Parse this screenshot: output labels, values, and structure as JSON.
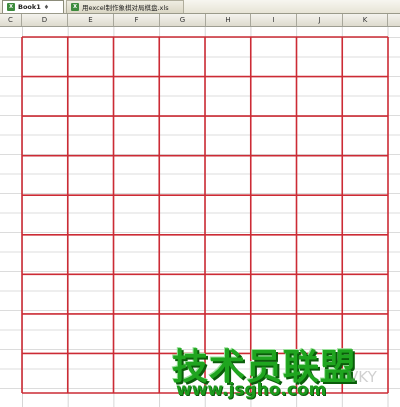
{
  "tabs": [
    {
      "label": "Book1",
      "marker": "♦",
      "active": true
    },
    {
      "label": "用excel制作象棋对局棋盘.xls",
      "active": false
    }
  ],
  "columns": [
    "C",
    "D",
    "E",
    "F",
    "G",
    "H",
    "I",
    "J",
    "K"
  ],
  "board": {
    "line_color": "#cc2b35",
    "files": 9,
    "ranks": 10
  },
  "watermark": {
    "title": "技术员联盟",
    "url": "www.jsgho.com",
    "faint": "VKY"
  }
}
